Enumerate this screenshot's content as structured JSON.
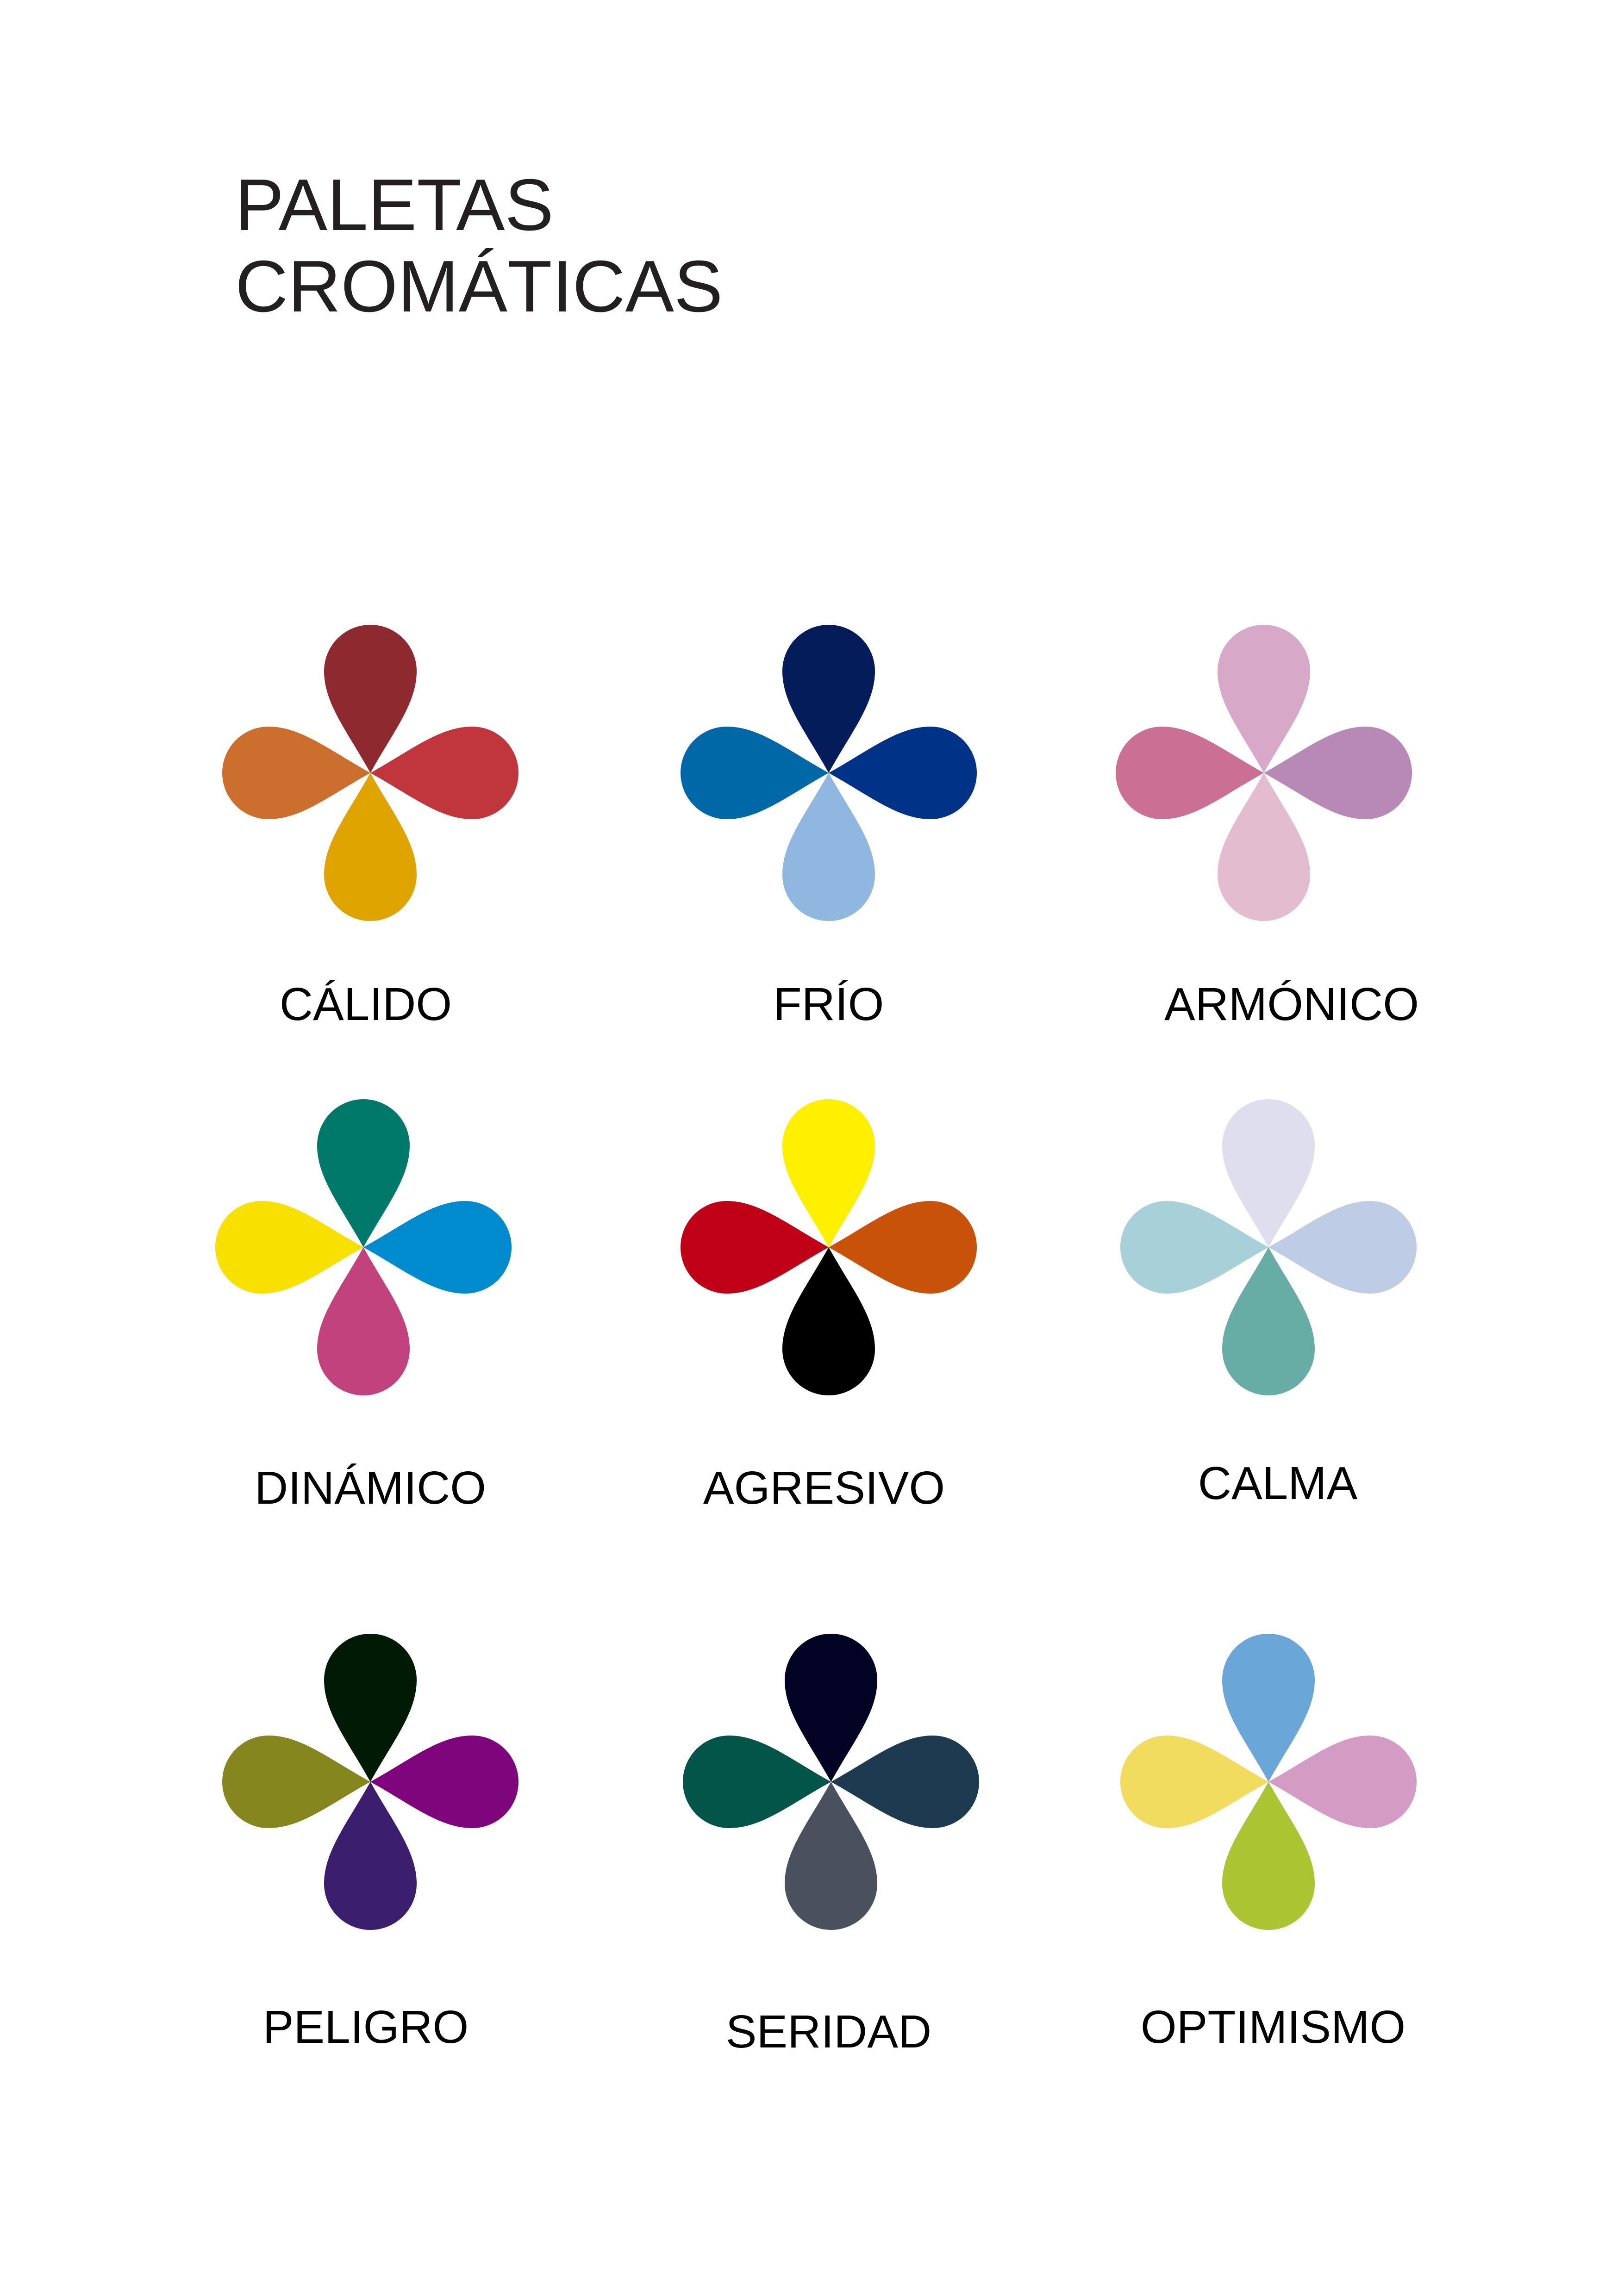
{
  "title": {
    "line1": "PALETAS",
    "line2": "CROMÁTICAS"
  },
  "palettes": [
    {
      "label": "CÁLIDO",
      "petals": {
        "top": "#8e2a2f",
        "right": "#c0363c",
        "bottom": "#e0a400",
        "left": "#cc6e2e"
      }
    },
    {
      "label": "FRÍO",
      "petals": {
        "top": "#041c5a",
        "right": "#003388",
        "bottom": "#8fb7e0",
        "left": "#0068a6"
      }
    },
    {
      "label": "ARMÓNICO",
      "petals": {
        "top": "#d8a8c8",
        "right": "#b888b6",
        "bottom": "#e4bcd0",
        "left": "#cb7094"
      }
    },
    {
      "label": "DINÁMICO",
      "petals": {
        "top": "#00786a",
        "right": "#008bcf",
        "bottom": "#c2427e",
        "left": "#f8e000"
      }
    },
    {
      "label": "AGRESIVO",
      "petals": {
        "top": "#fff000",
        "right": "#c8520a",
        "bottom": "#000000",
        "left": "#c00016"
      }
    },
    {
      "label": "CALMA",
      "petals": {
        "top": "#dedeee",
        "right": "#becce6",
        "bottom": "#68aca6",
        "left": "#a8d0d8"
      }
    },
    {
      "label": "PELIGRO",
      "petals": {
        "top": "#001a05",
        "right": "#7e057c",
        "bottom": "#3c1e6e",
        "left": "#86861f"
      }
    },
    {
      "label": "SERIDAD",
      "petals": {
        "top": "#010224",
        "right": "#1e3a50",
        "bottom": "#4a505e",
        "left": "#025548"
      }
    },
    {
      "label": "OPTIMISMO",
      "petals": {
        "top": "#6aa6d8",
        "right": "#d49cc4",
        "bottom": "#aac432",
        "left": "#f2dc60"
      }
    }
  ]
}
